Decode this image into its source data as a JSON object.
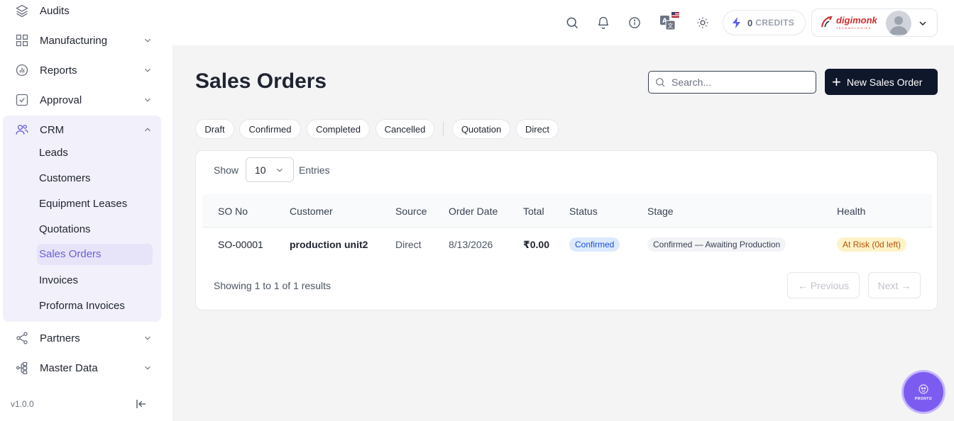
{
  "sidebar": {
    "items": [
      {
        "label": "Audits",
        "icon": "layers-icon"
      },
      {
        "label": "Manufacturing",
        "icon": "grid-icon"
      },
      {
        "label": "Reports",
        "icon": "bar-chart-icon"
      },
      {
        "label": "Approval",
        "icon": "checkbox-icon"
      },
      {
        "label": "CRM",
        "icon": "users-icon"
      },
      {
        "label": "Partners",
        "icon": "share-icon"
      },
      {
        "label": "Master Data",
        "icon": "hierarchy-icon"
      }
    ],
    "crm_sub": [
      "Leads",
      "Customers",
      "Equipment Leases",
      "Quotations",
      "Sales Orders",
      "Invoices",
      "Proforma Invoices"
    ],
    "active_sub": "Sales Orders",
    "version": "v1.0.0"
  },
  "header": {
    "credits_count": "0",
    "credits_label": "CREDITS",
    "brand": "digimonk",
    "brand_tag": "TECHNOLOGIES"
  },
  "main": {
    "title": "Sales Orders",
    "search_placeholder": "Search...",
    "new_button": "New Sales Order",
    "filters": [
      "Draft",
      "Confirmed",
      "Completed",
      "Cancelled",
      "Quotation",
      "Direct"
    ],
    "show_label": "Show",
    "entries_value": "10",
    "entries_label": "Entries",
    "columns": [
      "SO No",
      "Customer",
      "Source",
      "Order Date",
      "Total",
      "Status",
      "Stage",
      "Health"
    ],
    "rows": [
      {
        "so_no": "SO-00001",
        "customer": "production unit2",
        "source": "Direct",
        "order_date": "8/13/2026",
        "total": "₹0.00",
        "status": "Confirmed",
        "stage": "Confirmed — Awaiting Production",
        "health": "At Risk (0d left)"
      }
    ],
    "showing_text": "Showing 1 to 1 of 1 results",
    "prev_label": "← Previous",
    "next_label": "Next →"
  },
  "fab": {
    "label": "PRONTO"
  },
  "colors": {
    "accent": "#6a5fd8",
    "primary_button": "#0f172a",
    "status_badge": "#dbeafe",
    "health_badge": "#fef3c7",
    "fab": "#7c5cf0"
  }
}
